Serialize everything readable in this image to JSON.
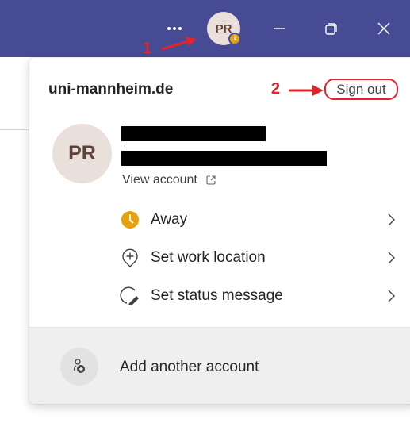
{
  "titlebar": {
    "more_icon": "more-horizontal-icon",
    "avatar_initials": "PR",
    "presence": "away",
    "presence_color": "#e8a00b",
    "minimize_icon": "minimize-icon",
    "restore_icon": "restore-icon",
    "close_icon": "close-icon",
    "background_color": "#464b94"
  },
  "panel": {
    "org_name": "uni-mannheim.de",
    "sign_out_label": "Sign out",
    "avatar_initials": "PR",
    "user_name": "[redacted]",
    "user_email": "[redacted]",
    "view_account_label": "View account",
    "menu_items": [
      {
        "label": "Away",
        "icon": "away-clock-icon",
        "chevron": "chevron-right-icon"
      },
      {
        "label": "Set work location",
        "icon": "location-add-icon",
        "chevron": "chevron-right-icon"
      },
      {
        "label": "Set status message",
        "icon": "status-message-edit-icon",
        "chevron": "chevron-right-icon"
      }
    ],
    "add_account_label": "Add another account",
    "add_account_icon": "person-add-icon"
  },
  "annotations": [
    {
      "number": "1",
      "target": "titlebar avatar"
    },
    {
      "number": "2",
      "target": "Sign out"
    }
  ],
  "colors": {
    "annotation_red": "#e3242b",
    "away_amber": "#e8a00b"
  }
}
